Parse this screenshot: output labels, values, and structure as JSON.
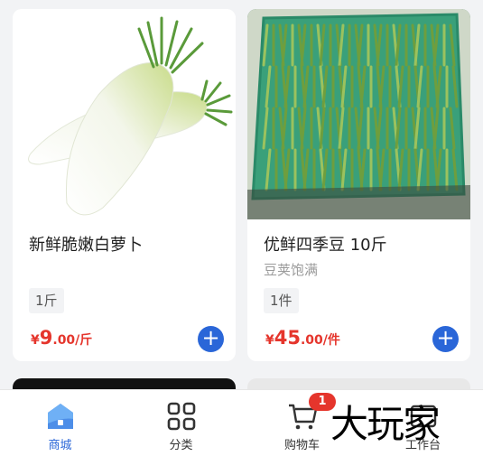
{
  "products": [
    {
      "title": "新鲜脆嫩白萝卜",
      "subtitle": "",
      "unit": "1斤",
      "price_currency": "¥",
      "price_integer": "9",
      "price_rest": ".00/斤",
      "add_label": "+"
    },
    {
      "title": "优鲜四季豆 10斤",
      "subtitle": "豆荚饱满",
      "unit": "1件",
      "price_currency": "¥",
      "price_integer": "45",
      "price_rest": ".00/件",
      "add_label": "+"
    }
  ],
  "tabbar": {
    "tabs": [
      {
        "label": "商城",
        "icon": "home-icon",
        "active": true
      },
      {
        "label": "分类",
        "icon": "grid-icon",
        "active": false
      },
      {
        "label": "购物车",
        "icon": "cart-icon",
        "active": false
      },
      {
        "label": "工作台",
        "icon": "workbench-icon",
        "active": false
      }
    ],
    "cart_badge": "1"
  },
  "watermark": "大玩家",
  "colors": {
    "accent": "#2a66d8",
    "price": "#e5352c",
    "badge": "#e5352c"
  }
}
